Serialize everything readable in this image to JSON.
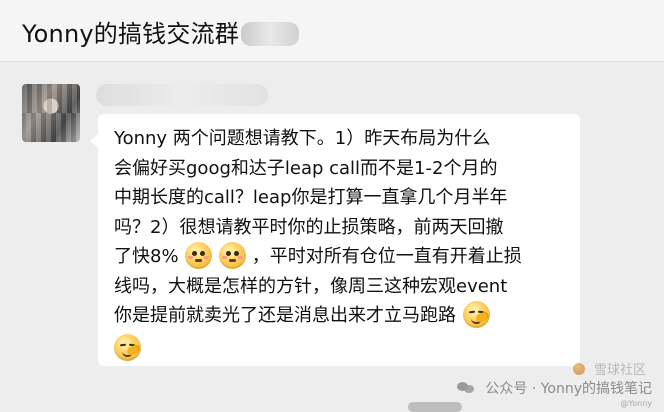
{
  "header": {
    "chat_title": "Yonny的搞钱交流群"
  },
  "message": {
    "lines": [
      "Yonny 两个问题想请教下。1）昨天布局为什么",
      "会偏好买goog和达子leap call而不是1-2个月的",
      "中期长度的call？leap你是打算一直拿几个月半年",
      "吗？2）很想请教平时你的止损策略，前两天回撤",
      "了快8%",
      "，平时对所有仓位一直有开着止损",
      "线吗，大概是怎样的方针，像周三这种宏观event",
      "你是提前就卖光了还是消息出来才立马跑路"
    ],
    "emojis": {
      "flushed_1": "flushed-face",
      "flushed_2": "flushed-face",
      "doge_1": "doge-face",
      "doge_2": "doge-face"
    }
  },
  "footer": {
    "watermark_label": "公众号 · Yonny的搞钱笔记",
    "watermark_top": "雪球社区",
    "watermark_handle": "@Yonny"
  }
}
